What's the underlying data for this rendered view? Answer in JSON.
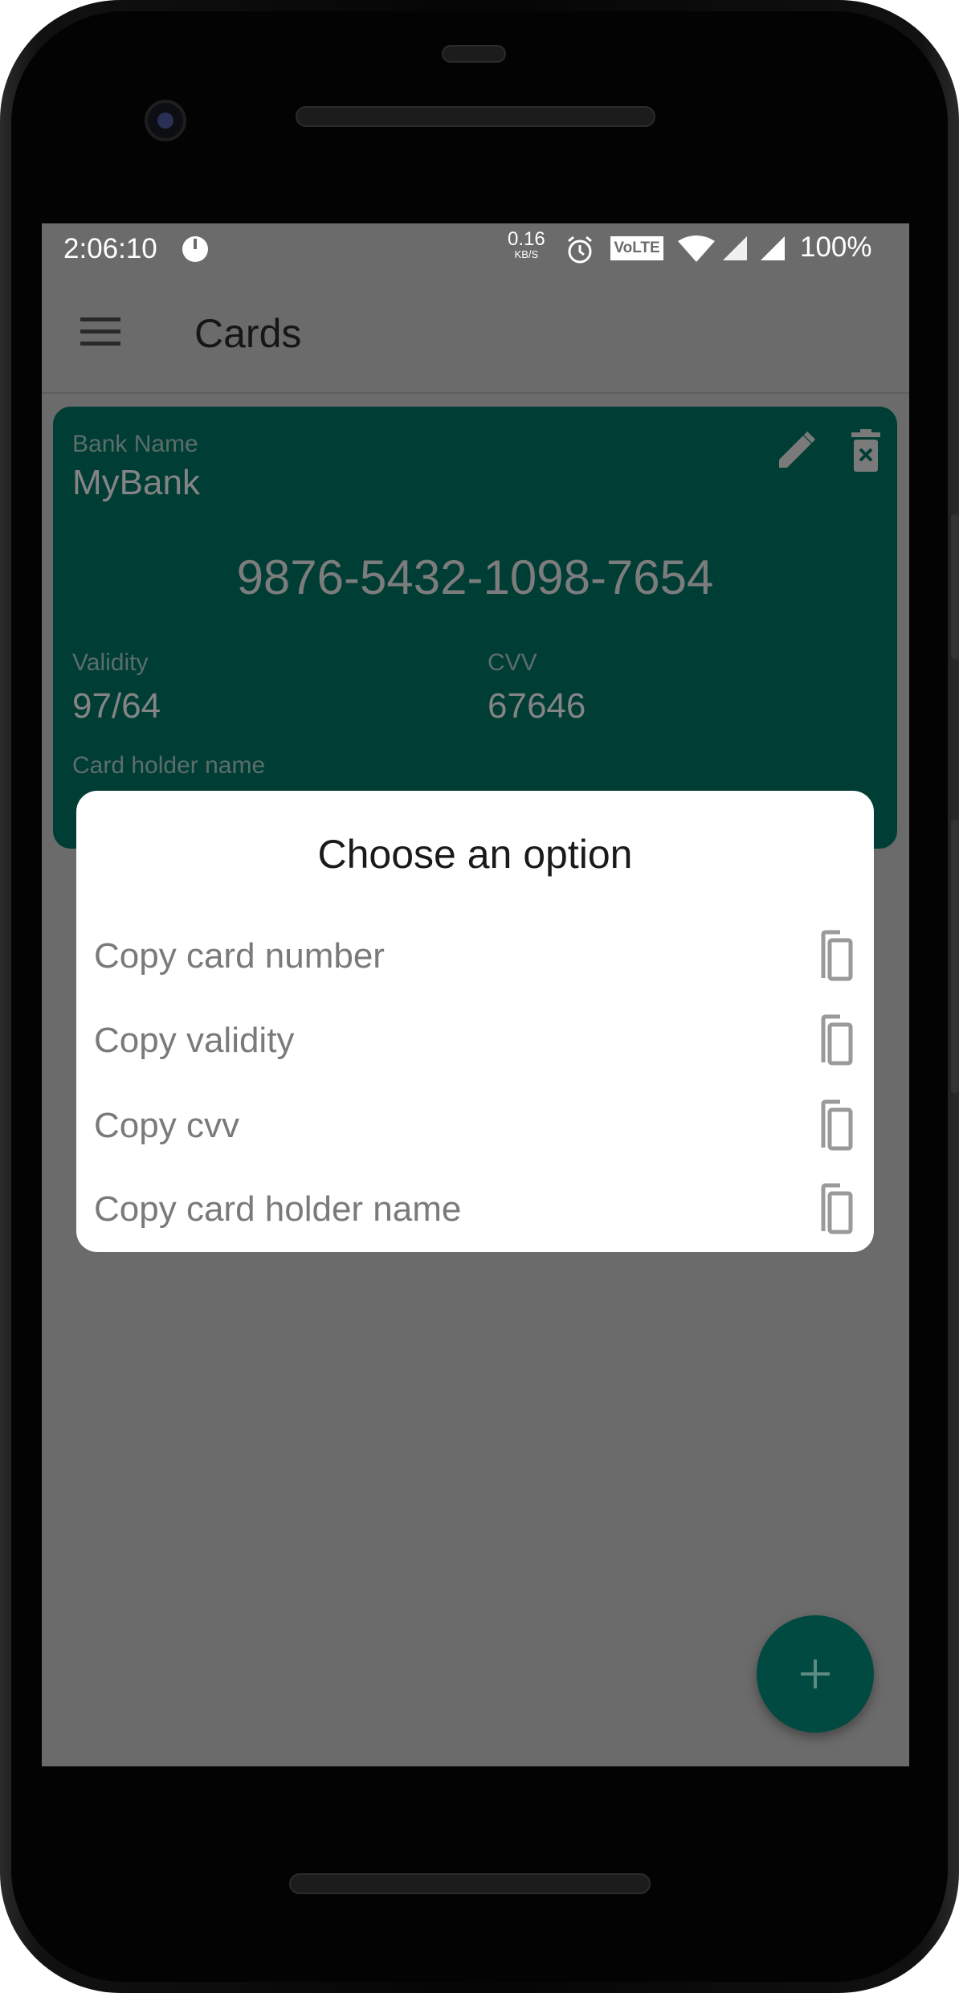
{
  "status_bar": {
    "time": "2:06:10",
    "net_speed": "0.16",
    "net_unit": "KB/S",
    "volte": "VoLTE",
    "battery": "100%"
  },
  "app_bar": {
    "title": "Cards",
    "menu_icon": "hamburger-icon"
  },
  "card": {
    "bank_label": "Bank Name",
    "bank_name": "MyBank",
    "card_number": "9876-5432-1098-7654",
    "validity_label": "Validity",
    "validity": "97/64",
    "cvv_label": "CVV",
    "cvv": "67646",
    "holder_label": "Card holder name",
    "color": "#003d35"
  },
  "dialog": {
    "title": "Choose an option",
    "options": [
      {
        "label": "Copy card number",
        "icon": "copy-icon"
      },
      {
        "label": "Copy validity",
        "icon": "copy-icon"
      },
      {
        "label": "Copy cvv",
        "icon": "copy-icon"
      },
      {
        "label": "Copy card holder name",
        "icon": "copy-icon"
      }
    ]
  },
  "fab": {
    "icon": "plus-icon",
    "label": "+"
  }
}
